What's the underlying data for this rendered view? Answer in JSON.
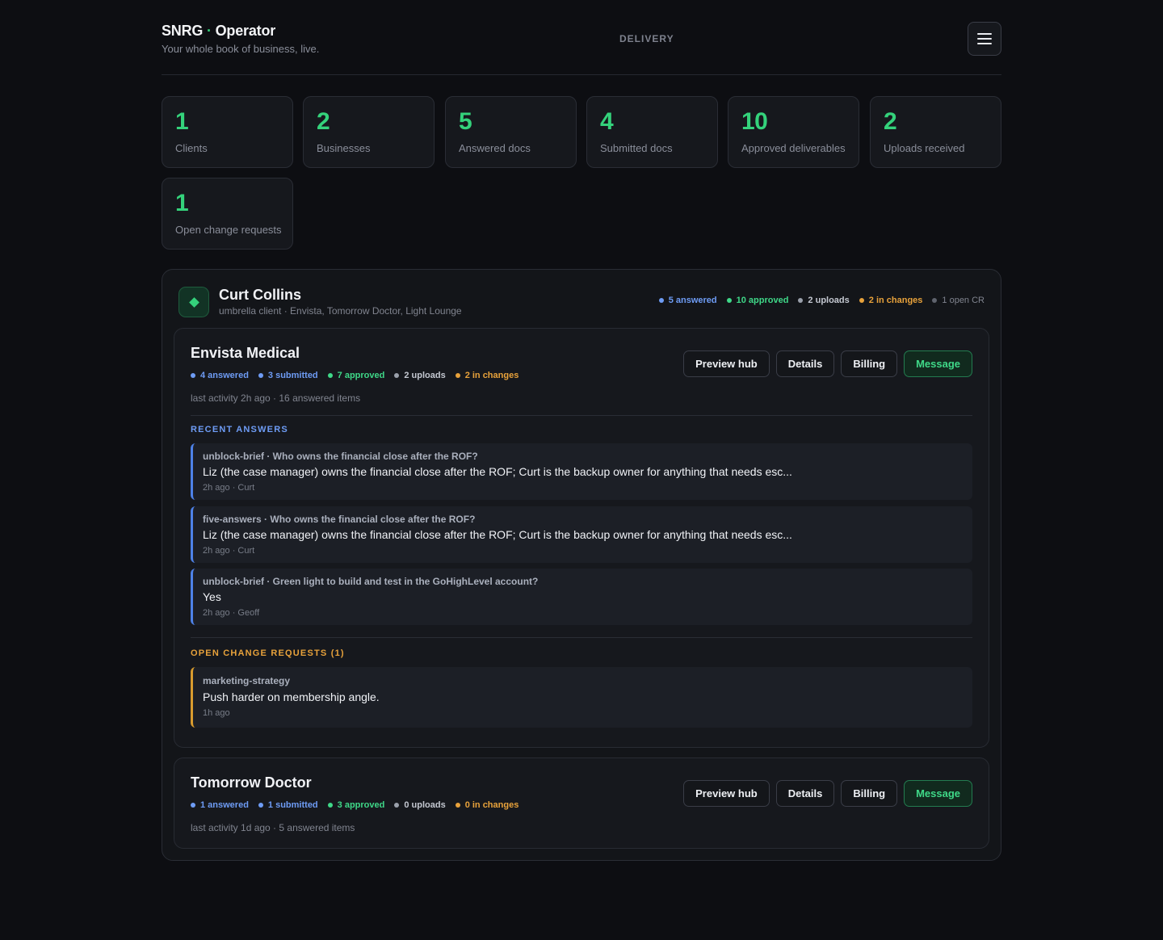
{
  "header": {
    "brand_main": "SNRG",
    "brand_sep": " · ",
    "brand_sub": "Operator",
    "tagline": "Your whole book of business, live.",
    "nav_label": "DELIVERY"
  },
  "stats": [
    {
      "value": "1",
      "label": "Clients"
    },
    {
      "value": "2",
      "label": "Businesses"
    },
    {
      "value": "5",
      "label": "Answered docs"
    },
    {
      "value": "4",
      "label": "Submitted docs"
    },
    {
      "value": "10",
      "label": "Approved deliverables"
    },
    {
      "value": "2",
      "label": "Uploads received"
    },
    {
      "value": "1",
      "label": "Open change requests"
    }
  ],
  "colors": {
    "accent_green": "#34d27b",
    "answered_blue": "#6e9cf5",
    "approved_green": "#3fd888",
    "uploads_gray": "#9aa0ab",
    "changes_orange": "#e8a23b"
  },
  "client": {
    "icon": "diamond-icon",
    "name": "Curt Collins",
    "subtitle": "umbrella client · Envista, Tomorrow Doctor, Light Lounge",
    "pills": {
      "answered": "5 answered",
      "approved": "10 approved",
      "uploads": "2 uploads",
      "changes": "2 in changes",
      "open_cr": "1 open CR"
    },
    "businesses": [
      {
        "name": "Envista Medical",
        "pills": {
          "answered": "4 answered",
          "submitted": "3 submitted",
          "approved": "7 approved",
          "uploads": "2 uploads",
          "changes": "2 in changes"
        },
        "meta": "last activity 2h ago · 16 answered items",
        "actions": {
          "preview": "Preview hub",
          "details": "Details",
          "billing": "Billing",
          "message": "Message"
        },
        "recent_title": "RECENT ANSWERS",
        "answers": [
          {
            "question": "unblock-brief · Who owns the financial close after the ROF?",
            "answer": "Liz (the case manager) owns the financial close after the ROF; Curt is the backup owner for anything that needs esc...",
            "meta": "2h ago · Curt"
          },
          {
            "question": "five-answers · Who owns the financial close after the ROF?",
            "answer": "Liz (the case manager) owns the financial close after the ROF; Curt is the backup owner for anything that needs esc...",
            "meta": "2h ago · Curt"
          },
          {
            "question": "unblock-brief · Green light to build and test in the GoHighLevel account?",
            "answer": "Yes",
            "meta": "2h ago · Geoff"
          }
        ],
        "cr_title": "OPEN CHANGE REQUESTS (1)",
        "change_requests": [
          {
            "doc": "marketing-strategy",
            "text": "Push harder on membership angle.",
            "meta": "1h ago"
          }
        ]
      },
      {
        "name": "Tomorrow Doctor",
        "pills": {
          "answered": "1 answered",
          "submitted": "1 submitted",
          "approved": "3 approved",
          "uploads": "0 uploads",
          "changes": "0 in changes"
        },
        "meta": "last activity 1d ago · 5 answered items",
        "actions": {
          "preview": "Preview hub",
          "details": "Details",
          "billing": "Billing",
          "message": "Message"
        }
      }
    ]
  }
}
